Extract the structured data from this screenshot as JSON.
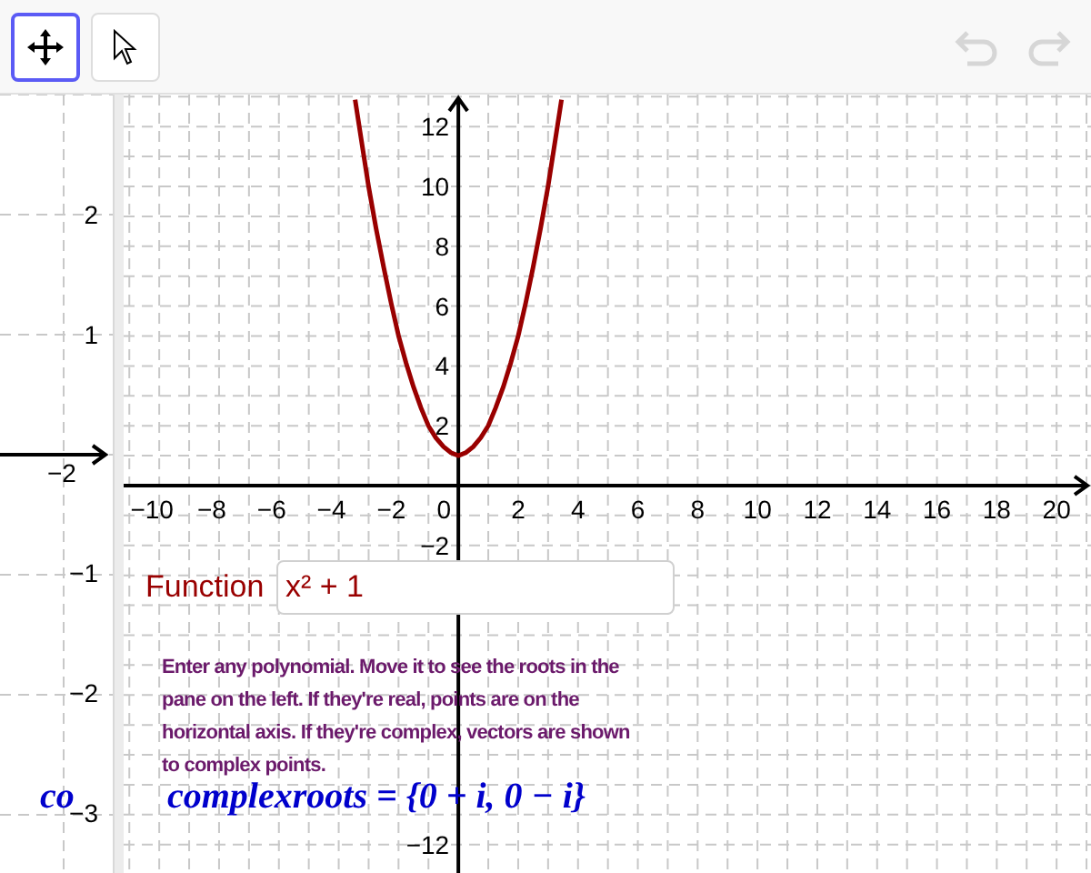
{
  "toolbar": {
    "tools": [
      {
        "kind": "move",
        "selected": true
      },
      {
        "kind": "pointer",
        "selected": false
      }
    ],
    "undo": {
      "disabled": true
    },
    "redo": {
      "disabled": true
    }
  },
  "left_pane": {
    "y_labels": [
      "2",
      "1",
      "−1",
      "−2",
      "−3"
    ],
    "x_label": "−2",
    "formula_fragment": "co"
  },
  "graph": {
    "function_label": "Function",
    "function_input": "x² + 1",
    "note": "Enter any polynomial. Move it to see the roots in the pane on the left. If they're real, points are on the horizontal axis. If they're complex, vectors are shown to complex points.",
    "formula": "complexroots = {0 + i, 0 − i}",
    "chart_data": {
      "type": "line",
      "grid": true,
      "x": [
        -3.45,
        -3.25,
        -3,
        -2.75,
        -2.5,
        -2.25,
        -2,
        -1.75,
        -1.5,
        -1.25,
        -1,
        -0.75,
        -0.5,
        -0.25,
        0,
        0.25,
        0.5,
        0.75,
        1,
        1.25,
        1.5,
        1.75,
        2,
        2.25,
        2.5,
        2.75,
        3,
        3.25,
        3.45
      ],
      "series": [
        {
          "color": "#990000",
          "values": [
            12.9,
            11.6,
            10,
            8.6,
            7.3,
            6.1,
            5,
            4.1,
            3.3,
            2.6,
            2,
            1.6,
            1.3,
            1.1,
            1,
            1.1,
            1.3,
            1.6,
            2,
            2.6,
            3.3,
            4.1,
            5,
            6.1,
            7.3,
            8.6,
            10,
            11.6,
            12.9
          ]
        }
      ],
      "xlim": [
        -11.19,
        21.15
      ],
      "ylim": [
        -12.95,
        13.07
      ],
      "xticks": [
        {
          "value": -10,
          "label": "−10"
        },
        {
          "value": -8,
          "label": "−8"
        },
        {
          "value": -6,
          "label": "−6"
        },
        {
          "value": -4,
          "label": "−4"
        },
        {
          "value": -2,
          "label": "−2"
        },
        0,
        2,
        4,
        6,
        8,
        10,
        12,
        14,
        16,
        18,
        20
      ],
      "yticks": [
        2,
        4,
        6,
        8,
        10,
        12,
        {
          "value": -2,
          "label": "−2"
        },
        {
          "value": -12,
          "label": "−12"
        }
      ]
    }
  }
}
